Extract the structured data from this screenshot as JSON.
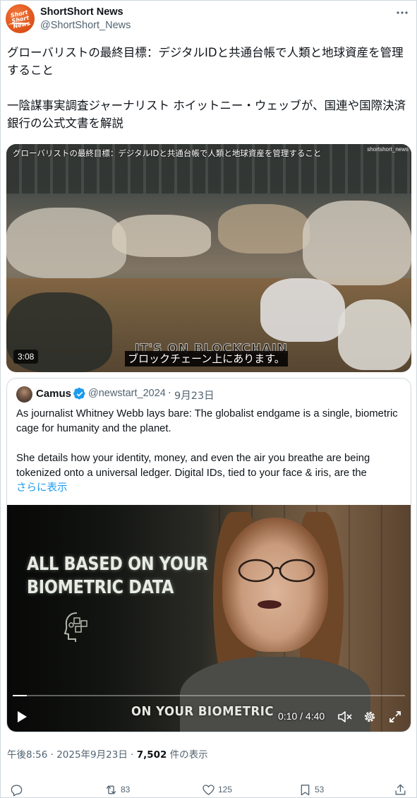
{
  "author": {
    "display_name": "ShortShort News",
    "handle": "@ShortShort_News",
    "avatar_text": "Short Short News",
    "more_icon": "more-horizontal-icon"
  },
  "tweet": {
    "text": "グローバリストの最終目標：デジタルIDと共通台帳で人類と地球資産を管理すること\n\n一陰謀事実調査ジャーナリスト ホイットニー・ウェッブが、国連や国際決済銀行の公式文書を解説"
  },
  "video1": {
    "title_overlay": "グローバリストの最終目標：デジタルIDと共通台帳で人類と地球資産を管理すること",
    "watermark": "shortshort_news",
    "duration": "3:08",
    "burned_caption": "IT'S ON BLOCKCHAIN",
    "subtitle": "ブロックチェーン上にあります。"
  },
  "quote": {
    "name": "Camus",
    "verified_icon": "verified-badge-icon",
    "handle": "@newstart_2024",
    "separator": "·",
    "date": "9月23日",
    "text": "As journalist Whitney Webb lays bare: The globalist endgame is a single, biometric cage for humanity and the planet.\n\nShe details how your identity, money, and even the air you breathe are being tokenized onto a universal ledger. Digital IDs, tied to your face & iris, are the",
    "show_more": "さらに表示",
    "video": {
      "heading": "ALL BASED ON YOUR\nBIOMETRIC DATA",
      "caption": "ON YOUR BIOMETRIC",
      "time": "0:10 / 4:40",
      "progress": 0.036,
      "controls": [
        "play-icon",
        "mute-icon",
        "settings-icon",
        "fullscreen-icon"
      ]
    }
  },
  "meta": {
    "time_date": "午後8:56 · 2025年9月23日 · ",
    "views": "7,502",
    "views_suffix": " 件の表示"
  },
  "actions": {
    "reply_count": "",
    "retweet_count": "83",
    "like_count": "125",
    "bookmark_count": "53"
  },
  "colors": {
    "accent": "#1d9bf0",
    "text": "#0f1419",
    "secondary": "#536471",
    "border": "#cfd9de",
    "avatar": "#e2561c"
  }
}
